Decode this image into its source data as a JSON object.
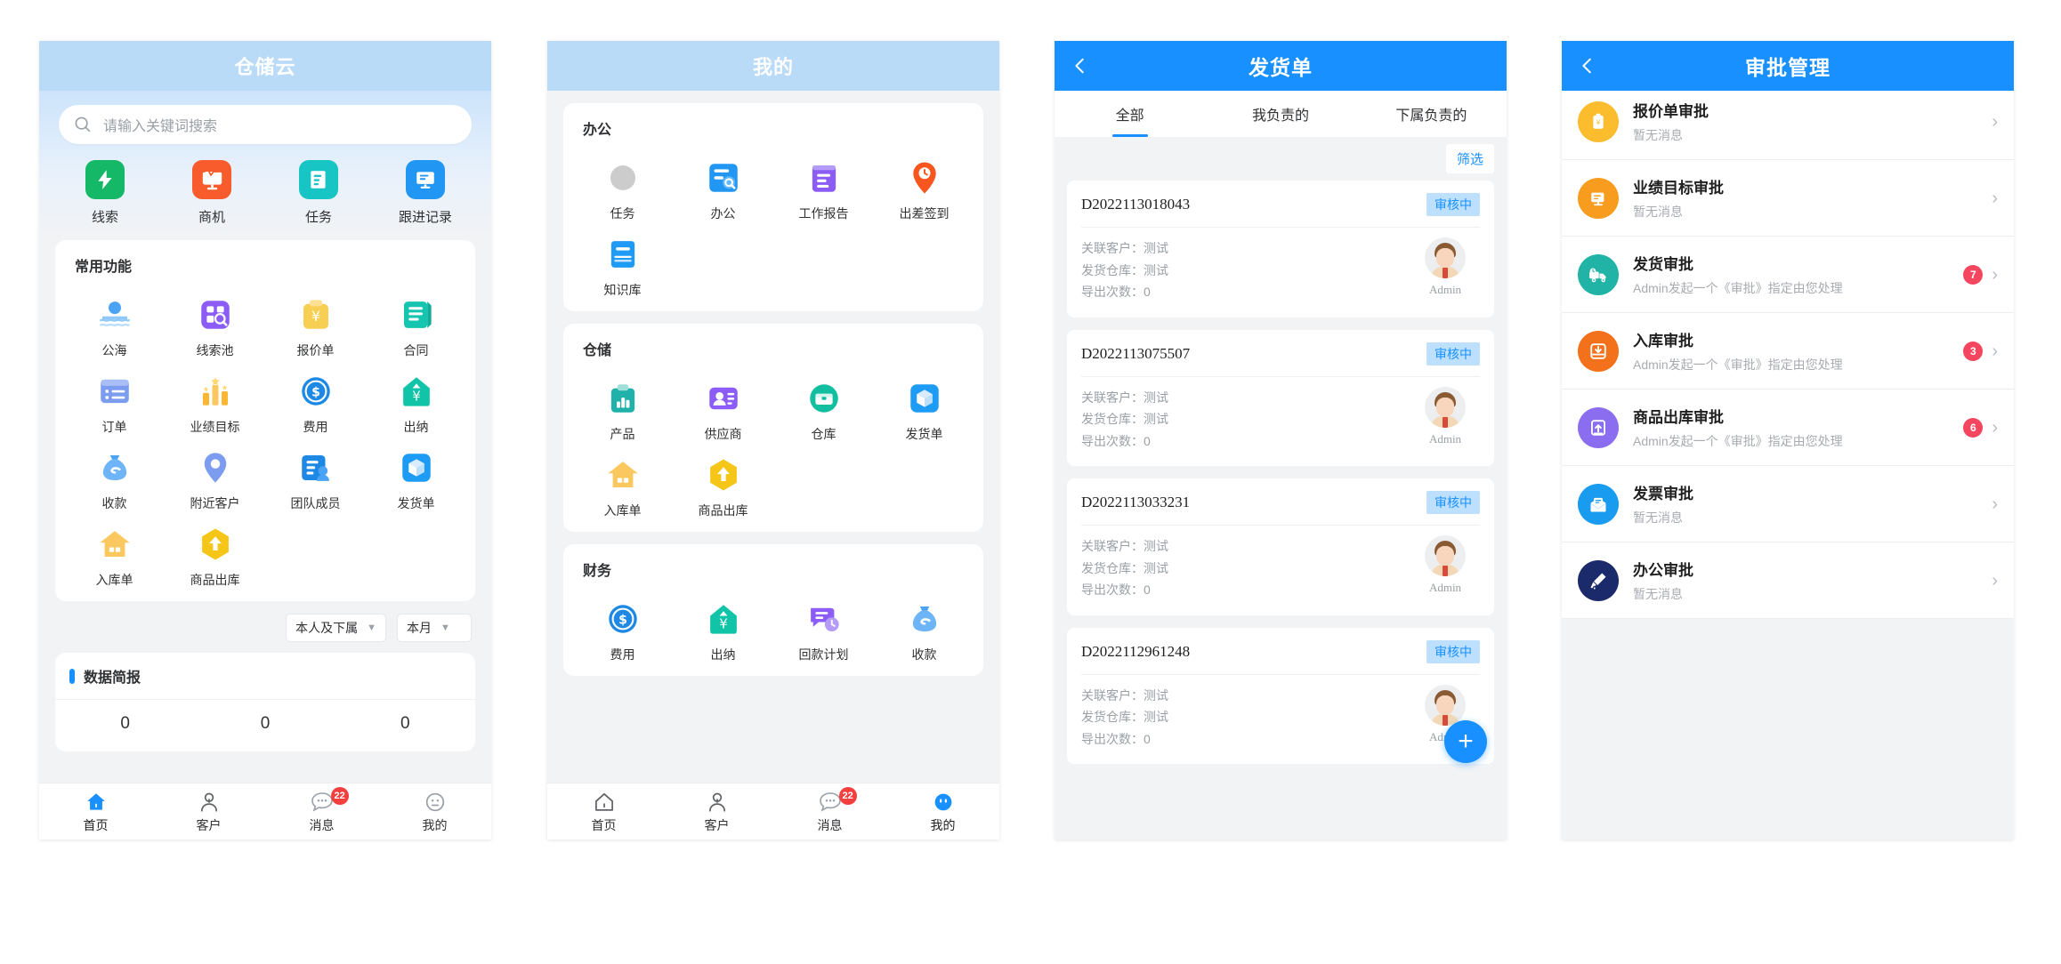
{
  "colors": {
    "primary_blue": "#1890ff",
    "header_light_blue": "#b9dbf7",
    "badge_red": "#f4465e",
    "status_chip_bg": "#bde0ff",
    "page_bg": "#f2f3f5"
  },
  "phone1": {
    "header": {
      "title": "仓储云"
    },
    "search": {
      "placeholder": "请输入关键词搜索",
      "icon": "search-icon"
    },
    "quick_actions": [
      {
        "label": "线索",
        "icon": "lightning-icon",
        "color": "#14b866"
      },
      {
        "label": "商机",
        "icon": "monitor-pulse-icon",
        "color": "#f85c2c"
      },
      {
        "label": "任务",
        "icon": "task-doc-icon",
        "color": "#18c5c5"
      },
      {
        "label": "跟进记录",
        "icon": "screen-record-icon",
        "color": "#2196f3"
      }
    ],
    "common_functions": {
      "title": "常用功能",
      "items": [
        {
          "label": "公海",
          "icon": "public-sea-icon",
          "color": "#4aa3f5"
        },
        {
          "label": "线索池",
          "icon": "clue-pool-icon",
          "color": "#8b5cf6"
        },
        {
          "label": "报价单",
          "icon": "quotation-icon",
          "color": "#f7cf52"
        },
        {
          "label": "合同",
          "icon": "contract-icon",
          "color": "#16c5b0"
        },
        {
          "label": "订单",
          "icon": "order-list-icon",
          "color": "#7c9cf0"
        },
        {
          "label": "业绩目标",
          "icon": "performance-target-icon",
          "color": "#fbb731"
        },
        {
          "label": "费用",
          "icon": "expense-coin-icon",
          "color": "#1e88e5"
        },
        {
          "label": "出纳",
          "icon": "cashier-icon",
          "color": "#11c4a8"
        },
        {
          "label": "收款",
          "icon": "receipt-money-bag-icon",
          "color": "#4aa3f5"
        },
        {
          "label": "附近客户",
          "icon": "nearby-customer-pin-icon",
          "color": "#7c9cf0"
        },
        {
          "label": "团队成员",
          "icon": "team-member-icon",
          "color": "#1e88e5"
        },
        {
          "label": "发货单",
          "icon": "delivery-box-icon",
          "color": "#1e9bf5"
        },
        {
          "label": "入库单",
          "icon": "inbound-house-icon",
          "color": "#fbc85f"
        },
        {
          "label": "商品出库",
          "icon": "outbound-arrow-icon",
          "color": "#f5c518"
        }
      ]
    },
    "filters": [
      {
        "value": "本人及下属",
        "icon": "chevron-down-icon"
      },
      {
        "value": "本月",
        "icon": "chevron-down-icon"
      }
    ],
    "brief": {
      "title": "数据简报",
      "values": [
        "0",
        "0",
        "0"
      ]
    },
    "tabbar": [
      {
        "label": "首页",
        "icon": "home-icon",
        "active": true,
        "badge": ""
      },
      {
        "label": "客户",
        "icon": "customer-person-icon",
        "active": false,
        "badge": ""
      },
      {
        "label": "消息",
        "icon": "message-bubble-icon",
        "active": false,
        "badge": "22"
      },
      {
        "label": "我的",
        "icon": "profile-face-icon",
        "active": false,
        "badge": ""
      }
    ]
  },
  "phone2": {
    "header": {
      "title": "我的"
    },
    "sections": [
      {
        "title": "办公",
        "items": [
          {
            "label": "任务",
            "icon": "task-doc-icon",
            "color": "#18c5c5"
          },
          {
            "label": "办公",
            "icon": "office-search-icon",
            "color": "#2196f3"
          },
          {
            "label": "工作报告",
            "icon": "work-report-icon",
            "color": "#8b5cf6"
          },
          {
            "label": "出差签到",
            "icon": "trip-checkin-pin-icon",
            "color": "#f8551f"
          },
          {
            "label": "知识库",
            "icon": "knowledge-book-icon",
            "color": "#1e9bf5"
          }
        ]
      },
      {
        "title": "仓储",
        "items": [
          {
            "label": "产品",
            "icon": "product-chart-icon",
            "color": "#20b2aa"
          },
          {
            "label": "供应商",
            "icon": "supplier-card-icon",
            "color": "#8b5cf6"
          },
          {
            "label": "仓库",
            "icon": "warehouse-circle-icon",
            "color": "#11bfa0"
          },
          {
            "label": "发货单",
            "icon": "delivery-box-icon",
            "color": "#1e9bf5"
          },
          {
            "label": "入库单",
            "icon": "inbound-house-icon",
            "color": "#fbc85f"
          },
          {
            "label": "商品出库",
            "icon": "outbound-arrow-icon",
            "color": "#f5c518"
          }
        ]
      },
      {
        "title": "财务",
        "items": [
          {
            "label": "费用",
            "icon": "expense-coin-icon",
            "color": "#1e88e5"
          },
          {
            "label": "出纳",
            "icon": "cashier-icon",
            "color": "#11c4a8"
          },
          {
            "label": "回款计划",
            "icon": "payback-plan-icon",
            "color": "#8b5cf6"
          },
          {
            "label": "收款",
            "icon": "receipt-money-bag-icon",
            "color": "#4aa3f5"
          }
        ]
      }
    ],
    "tabbar": [
      {
        "label": "首页",
        "icon": "home-icon",
        "active": false,
        "badge": ""
      },
      {
        "label": "客户",
        "icon": "customer-person-icon",
        "active": false,
        "badge": ""
      },
      {
        "label": "消息",
        "icon": "message-bubble-icon",
        "active": false,
        "badge": "22"
      },
      {
        "label": "我的",
        "icon": "profile-face-icon",
        "active": true,
        "badge": ""
      }
    ]
  },
  "phone3": {
    "header": {
      "title": "发货单",
      "back_icon": "back-chevron-icon"
    },
    "tabs": [
      {
        "label": "全部",
        "active": true
      },
      {
        "label": "我负责的",
        "active": false
      },
      {
        "label": "下属负责的",
        "active": false
      }
    ],
    "filter_button": {
      "label": "筛选"
    },
    "field_labels": {
      "customer": "关联客户：",
      "warehouse": "发货仓库：",
      "export_count": "导出次数："
    },
    "orders": [
      {
        "no": "D2022113018043",
        "status": "审核中",
        "customer": "测试",
        "warehouse": "测试",
        "export_count": "0",
        "owner": "Admin"
      },
      {
        "no": "D2022113075507",
        "status": "审核中",
        "customer": "测试",
        "warehouse": "测试",
        "export_count": "0",
        "owner": "Admin"
      },
      {
        "no": "D2022113033231",
        "status": "审核中",
        "customer": "测试",
        "warehouse": "测试",
        "export_count": "0",
        "owner": "Admin"
      },
      {
        "no": "D2022112961248",
        "status": "审核中",
        "customer": "测试",
        "warehouse": "测试",
        "export_count": "0",
        "owner": "Admin"
      }
    ],
    "fab": {
      "label": "+",
      "icon": "plus-icon"
    }
  },
  "phone4": {
    "header": {
      "title": "审批管理",
      "back_icon": "back-chevron-icon"
    },
    "rows": [
      {
        "title": "",
        "sub": "暂无消息",
        "badge": "",
        "icon": "card-red-icon",
        "color": "#ef3b3b",
        "clipped": true
      },
      {
        "title": "报价单审批",
        "sub": "暂无消息",
        "badge": "",
        "icon": "quotation-approval-icon",
        "color": "#fbbc2e",
        "clipped": false
      },
      {
        "title": "业绩目标审批",
        "sub": "暂无消息",
        "badge": "",
        "icon": "performance-approval-icon",
        "color": "#f79c1e",
        "clipped": false
      },
      {
        "title": "发货审批",
        "sub": "Admin发起一个《审批》指定由您处理",
        "badge": "7",
        "icon": "delivery-truck-approval-icon",
        "color": "#21b3a6",
        "clipped": false
      },
      {
        "title": "入库审批",
        "sub": "Admin发起一个《审批》指定由您处理",
        "badge": "3",
        "icon": "inbound-approval-icon",
        "color": "#f4711b",
        "clipped": false
      },
      {
        "title": "商品出库审批",
        "sub": "Admin发起一个《审批》指定由您处理",
        "badge": "6",
        "icon": "outbound-approval-icon",
        "color": "#8b6ef0",
        "clipped": false
      },
      {
        "title": "发票审批",
        "sub": "暂无消息",
        "badge": "",
        "icon": "invoice-approval-icon",
        "color": "#199cf0",
        "clipped": false
      },
      {
        "title": "办公审批",
        "sub": "暂无消息",
        "badge": "",
        "icon": "office-approval-icon",
        "color": "#1b2a6b",
        "clipped": false
      }
    ],
    "chevron_icon": "chevron-right-icon"
  }
}
